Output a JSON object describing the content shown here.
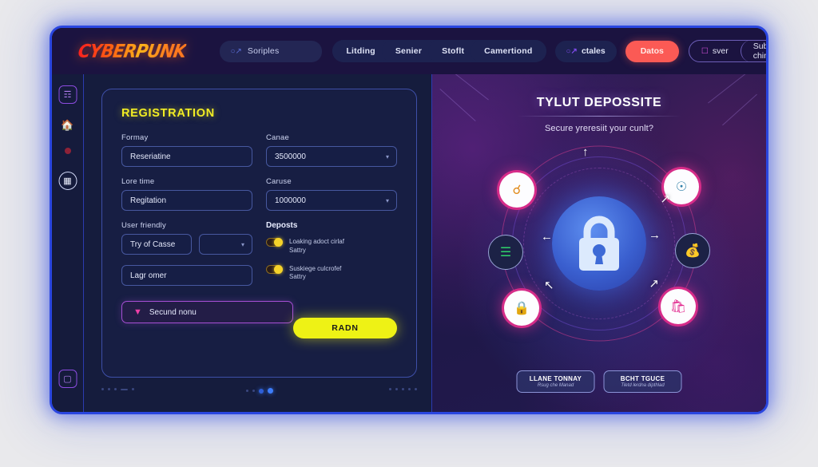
{
  "brand": {
    "logo_text": "CYBERPUNK"
  },
  "topnav": {
    "search": {
      "placeholder": "Soriples",
      "value": "Soriples",
      "icon": "search-icon"
    },
    "pills": [
      {
        "label": "Litding"
      },
      {
        "label": "Senier"
      },
      {
        "label": "Stoflt"
      },
      {
        "label": "Camertiond"
      }
    ],
    "chips": [
      {
        "label": "ctales",
        "icon": "search-icon",
        "accent": false
      },
      {
        "label": "Datos",
        "accent": true,
        "color": "#fb5a55"
      }
    ],
    "outline_group": [
      {
        "label": "sver",
        "icon": "ticket-icon"
      },
      {
        "label": "Suby ching"
      }
    ]
  },
  "sidebar": {
    "items": [
      {
        "name": "documents",
        "icon": "document-list-icon"
      },
      {
        "name": "home",
        "icon": "home-icon"
      },
      {
        "name": "status",
        "icon": "status-dot-icon"
      },
      {
        "name": "grid",
        "icon": "grid-icon"
      },
      {
        "name": "bookmark",
        "icon": "bookmark-icon"
      }
    ]
  },
  "form": {
    "title": "REGISTRATION",
    "fields": [
      {
        "label": "Formay",
        "value": "Reseriatine"
      },
      {
        "label": "Canae",
        "value": "3500000",
        "caret": true
      },
      {
        "label": "Lore time",
        "value": "Regitation"
      },
      {
        "label": "Caruse",
        "value": "1000000",
        "caret": true
      },
      {
        "label": "User friendly",
        "value": "Try of Casse"
      },
      {
        "label": "",
        "value": ""
      },
      {
        "label": "",
        "value": "Lagr omer"
      }
    ],
    "deposits_label": "Deposts",
    "toggles": [
      {
        "line1": "Loaking adoct cirlaf",
        "line2": "Sattry",
        "on": true
      },
      {
        "line1": "Suskiege culcrofef",
        "line2": "Sattry",
        "on": true
      }
    ],
    "secure_button": {
      "label": "Secund nonu",
      "icon": "chevron-v-icon"
    },
    "submit_button": {
      "label": "RADN"
    }
  },
  "hero": {
    "title": "TYLUT DEPOSSITE",
    "subtitle": "Secure yreresiit your cunlt?",
    "center_icon": "padlock-icon",
    "orbit_icons": [
      {
        "position": "top-left",
        "icon": "magnifier-icon",
        "style": "lit"
      },
      {
        "position": "top-right",
        "icon": "search-user-icon",
        "style": "lit"
      },
      {
        "position": "middle-left",
        "icon": "network-icon",
        "style": "dim"
      },
      {
        "position": "middle-right",
        "icon": "money-bag-icon",
        "style": "dim"
      },
      {
        "position": "bottom-left",
        "icon": "shield-lock-icon",
        "style": "lit"
      },
      {
        "position": "bottom-right",
        "icon": "shopping-bag-icon",
        "style": "lit"
      }
    ],
    "buttons": [
      {
        "title": "LLANE TONNAY",
        "subtitle": "Rsug che Manad"
      },
      {
        "title": "BCHT TGUCE",
        "subtitle": "Tletd lerdna dipthlad"
      }
    ]
  },
  "colors": {
    "accent_yellow": "#eef215",
    "accent_red": "#fb5a55",
    "accent_magenta": "#e12d8c",
    "border_blue": "#2a46e0"
  }
}
